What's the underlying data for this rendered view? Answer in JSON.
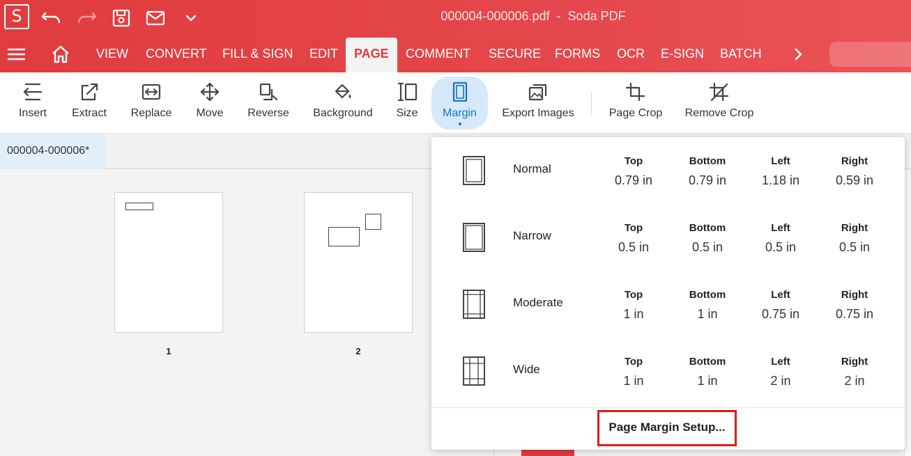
{
  "app": {
    "logo_letter": "S",
    "title": "000004-000006.pdf  -  Soda PDF"
  },
  "titlebar_icons": [
    "undo-icon",
    "redo-icon",
    "save-icon",
    "mail-icon",
    "chevron-down-icon"
  ],
  "menu": {
    "items": [
      "VIEW",
      "CONVERT",
      "FILL & SIGN",
      "EDIT",
      "PAGE",
      "COMMENT",
      "SECURE",
      "FORMS",
      "OCR",
      "E-SIGN",
      "BATCH"
    ],
    "active": "PAGE"
  },
  "ribbon": {
    "insert": "Insert",
    "extract": "Extract",
    "replace": "Replace",
    "move": "Move",
    "reverse": "Reverse",
    "background": "Background",
    "size": "Size",
    "margin": "Margin",
    "export_images": "Export Images",
    "page_crop": "Page Crop",
    "remove_crop": "Remove Crop"
  },
  "doc_tab": "000004-000006*",
  "thumbnails": [
    {
      "number": "1"
    },
    {
      "number": "2"
    }
  ],
  "margin_presets": [
    {
      "name": "Normal",
      "top_label": "Top",
      "top": "0.79 in",
      "bottom_label": "Bottom",
      "bottom": "0.79 in",
      "left_label": "Left",
      "left": "1.18 in",
      "right_label": "Right",
      "right": "0.59 in"
    },
    {
      "name": "Narrow",
      "top_label": "Top",
      "top": "0.5 in",
      "bottom_label": "Bottom",
      "bottom": "0.5 in",
      "left_label": "Left",
      "left": "0.5 in",
      "right_label": "Right",
      "right": "0.5 in"
    },
    {
      "name": "Moderate",
      "top_label": "Top",
      "top": "1 in",
      "bottom_label": "Bottom",
      "bottom": "1 in",
      "left_label": "Left",
      "left": "0.75 in",
      "right_label": "Right",
      "right": "0.75 in"
    },
    {
      "name": "Wide",
      "top_label": "Top",
      "top": "1 in",
      "bottom_label": "Bottom",
      "bottom": "1 in",
      "left_label": "Left",
      "left": "2 in",
      "right_label": "Right",
      "right": "2 in"
    }
  ],
  "page_margin_setup": "Page Margin Setup...",
  "colors": {
    "brand_red": "#e03c3f",
    "active_blue": "#1473c6",
    "active_bg": "#d5e9fb",
    "highlight": "#e01a1a"
  }
}
